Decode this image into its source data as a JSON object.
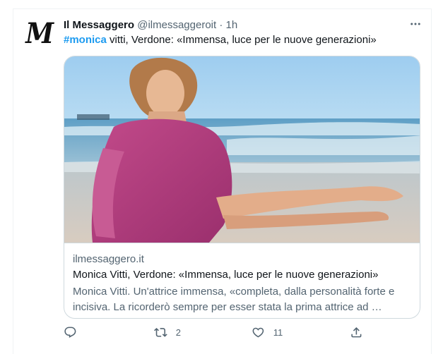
{
  "tweet": {
    "display_name": "Il Messaggero",
    "handle": "@ilmessaggeroit",
    "separator": "·",
    "time": "1h",
    "avatar_letter": "M",
    "hashtag": "#monica",
    "text_rest": " vitti, Verdone: «Immensa, luce per le nuove generazioni»"
  },
  "card": {
    "domain": "ilmessaggero.it",
    "title": "Monica Vitti, Verdone: «Immensa, luce per le nuove generazioni»",
    "description": "Monica Vitti. Un'attrice immensa, «completa, dalla personalità forte e incisiva. La ricorderò sempre per esser stata la prima attrice ad …"
  },
  "actions": {
    "reply_count": "",
    "retweet_count": "2",
    "like_count": "11",
    "icons": [
      "reply-icon",
      "retweet-icon",
      "like-icon",
      "share-icon"
    ]
  },
  "colors": {
    "accent": "#1d9bf0",
    "secondary_text": "#536471",
    "border": "#cfd9de"
  }
}
